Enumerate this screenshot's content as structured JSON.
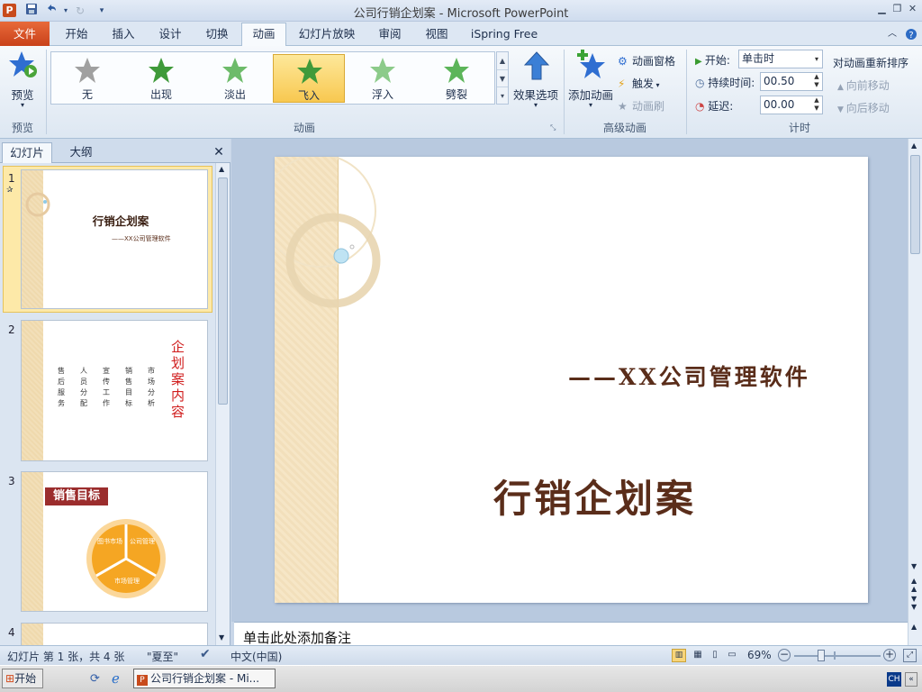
{
  "titlebar": {
    "app_icon": "P",
    "title": "公司行销企划案 - Microsoft PowerPoint",
    "qat": [
      "save-icon",
      "undo-icon",
      "redo-icon",
      "customize-icon"
    ]
  },
  "tabs": {
    "file": "文件",
    "items": [
      "开始",
      "插入",
      "设计",
      "切换",
      "动画",
      "幻灯片放映",
      "审阅",
      "视图",
      "iSpring Free"
    ],
    "active": "动画"
  },
  "ribbon": {
    "preview": {
      "label": "预览",
      "group": "预览"
    },
    "animations": {
      "group": "动画",
      "items": [
        {
          "label": "无",
          "color": "#9a9a9a"
        },
        {
          "label": "出现",
          "color": "#3f9a3a"
        },
        {
          "label": "淡出",
          "color": "#5cb55a"
        },
        {
          "label": "飞入",
          "color": "#3f9a3a"
        },
        {
          "label": "浮入",
          "color": "#7cc27a"
        },
        {
          "label": "劈裂",
          "color": "#5cb55a"
        }
      ],
      "selected": "飞入",
      "effect_options": "效果选项"
    },
    "advanced": {
      "group": "高级动画",
      "add_animation": "添加动画",
      "animation_pane": "动画窗格",
      "trigger": "触发",
      "animation_painter": "动画刷"
    },
    "timing": {
      "group": "计时",
      "start_label": "开始:",
      "start_value": "单击时",
      "duration_label": "持续时间:",
      "duration_value": "00.50",
      "delay_label": "延迟:",
      "delay_value": "00.00",
      "reorder_title": "对动画重新排序",
      "move_earlier": "向前移动",
      "move_later": "向后移动"
    }
  },
  "left_panel": {
    "tab_slides": "幻灯片",
    "tab_outline": "大纲",
    "slides": [
      {
        "number": "1",
        "title": "行销企划案",
        "subtitle": "——XX公司管理软件"
      },
      {
        "number": "2",
        "title": "企划案内容",
        "columns": [
          "售后服务",
          "人员分配",
          "宣传工作",
          "销售目标",
          "市场分析"
        ]
      },
      {
        "number": "3",
        "title": "销售目标",
        "segments": [
          "图书市场",
          "公司管理",
          "市场管理"
        ]
      },
      {
        "number": "4"
      }
    ]
  },
  "slide": {
    "subtitle": "——XX公司管理软件",
    "title": "行销企划案"
  },
  "notes": {
    "placeholder": "单击此处添加备注"
  },
  "status": {
    "slide_info": "幻灯片 第 1 张，共 4 张",
    "theme": "\"夏至\"",
    "language": "中文(中国)",
    "zoom": "69%"
  },
  "taskbar": {
    "start": "开始",
    "window": "公司行销企划案 - Mi...",
    "ime": "CH"
  },
  "colors": {
    "accent": "#c9411a",
    "title_text": "#5a2d1a",
    "thumb_red": "#d01c1c",
    "orange": "#f5a623"
  }
}
